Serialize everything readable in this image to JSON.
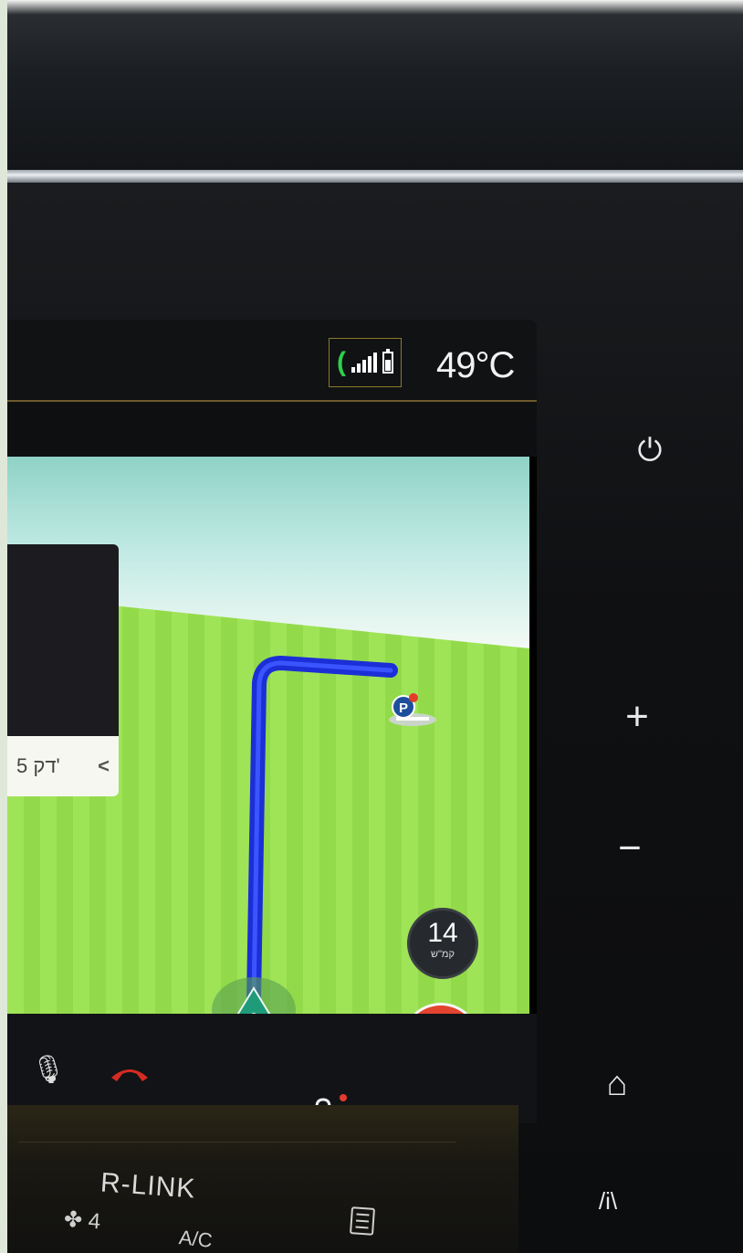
{
  "status_bar": {
    "temperature": "49°C",
    "icons": [
      "phone-icon",
      "signal-icon",
      "battery-icon"
    ]
  },
  "map": {
    "eta_label": "5 דק'",
    "eta_chevron": "<",
    "speed_value": "14",
    "speed_unit": "קמ\"ש",
    "parking_label": "P"
  },
  "bottom_bar": {
    "icons": [
      "microphone-icon",
      "hang-up-icon",
      "bell-icon"
    ]
  },
  "hardware": {
    "power": "⏻",
    "plus": "+",
    "minus": "−",
    "home": "⌂",
    "nav": "/i\\"
  },
  "console": {
    "brand": "R-LINK",
    "fan_level": "4",
    "ac_label": "A/C"
  },
  "colors": {
    "route": "#1c2fd6",
    "map_green": "#9fe457",
    "report_red": "#e2442f",
    "phone_green": "#2dd14b"
  }
}
